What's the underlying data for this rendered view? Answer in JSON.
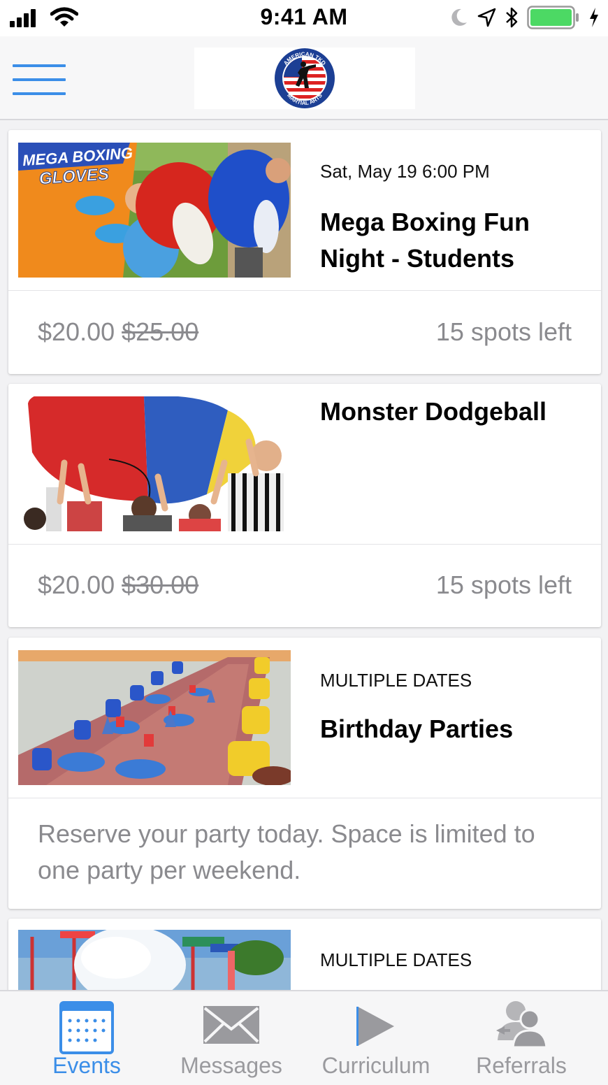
{
  "status_bar": {
    "time": "9:41 AM",
    "icons": [
      "signal-bars-icon",
      "wifi-icon",
      "moon-icon",
      "location-arrow-icon",
      "bluetooth-icon",
      "battery-icon",
      "charging-bolt-icon"
    ]
  },
  "nav": {
    "menu_icon": "hamburger-menu-icon",
    "logo_text_top": "AMERICAN TKD",
    "logo_text_bottom": "MARTIAL ARTS"
  },
  "events": [
    {
      "thumb_caption_1": "MEGA BOXING",
      "thumb_caption_2": "GLOVES",
      "date": "Sat, May 19 6:00 PM",
      "title": "Mega Boxing Fun Night - Students",
      "price": "$20.00",
      "original_price": "$25.00",
      "spots": "15 spots left"
    },
    {
      "date": "",
      "title": "Monster Dodgeball",
      "price": "$20.00",
      "original_price": "$30.00",
      "spots": "15 spots left"
    },
    {
      "date": "MULTIPLE DATES",
      "title": "Birthday Parties",
      "description": "Reserve your party today. Space is limited to one party per weekend."
    },
    {
      "date": "MULTIPLE DATES"
    }
  ],
  "tabs": [
    {
      "label": "Events",
      "icon": "calendar-icon",
      "active": true
    },
    {
      "label": "Messages",
      "icon": "envelope-icon",
      "active": false
    },
    {
      "label": "Curriculum",
      "icon": "play-icon",
      "active": false
    },
    {
      "label": "Referrals",
      "icon": "referral-people-icon",
      "active": false
    }
  ],
  "colors": {
    "accent": "#3b8ee8",
    "muted_text": "#8a8a8e",
    "background": "#f2f2f4",
    "tab_inactive": "#9a9a9e"
  }
}
